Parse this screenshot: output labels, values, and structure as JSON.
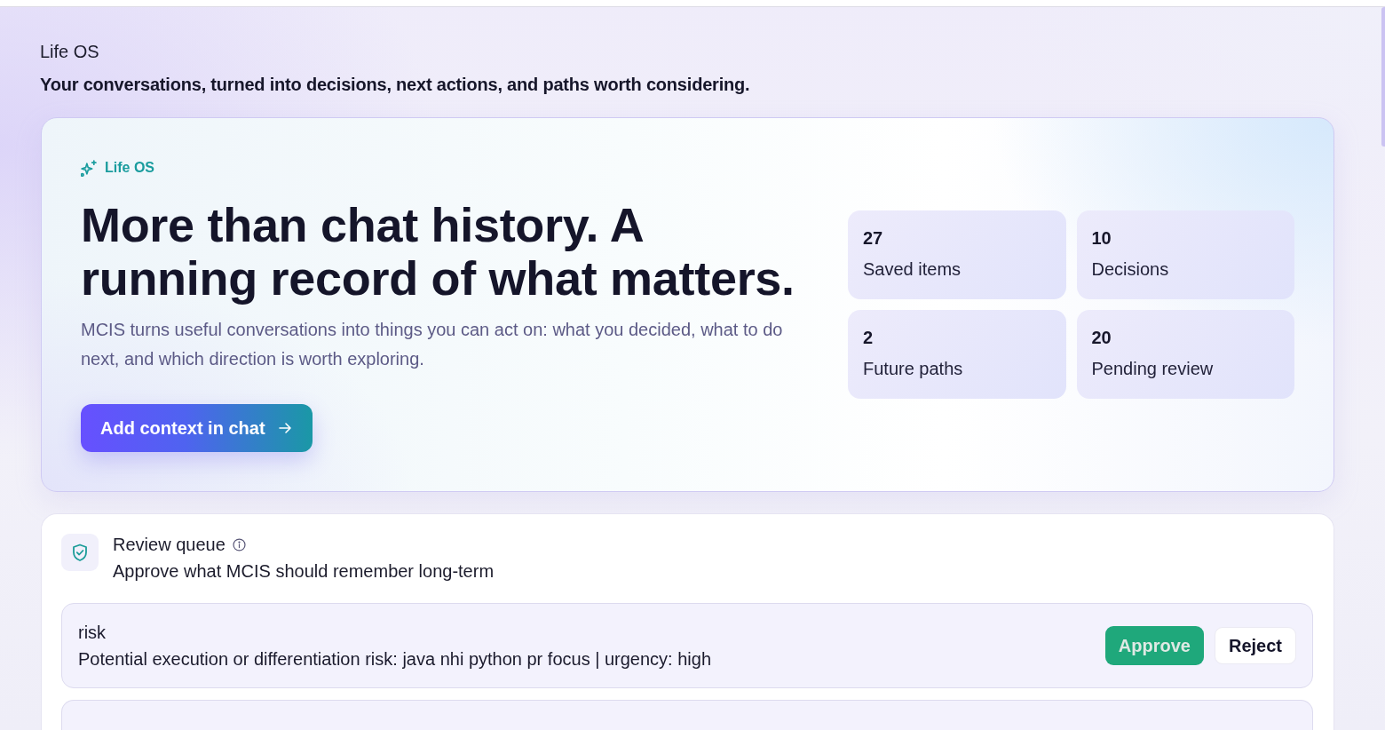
{
  "page": {
    "title": "Life OS",
    "subtitle": "Your conversations, turned into decisions, next actions, and paths worth considering."
  },
  "hero": {
    "badge": "Life OS",
    "headline": "More than chat history. A running record of what matters.",
    "description": "MCIS turns useful conversations into things you can act on: what you decided, what to do next, and which direction is worth exploring.",
    "button": "Add context in chat"
  },
  "stats": [
    {
      "value": "27",
      "label": "Saved items"
    },
    {
      "value": "10",
      "label": "Decisions"
    },
    {
      "value": "2",
      "label": "Future paths"
    },
    {
      "value": "20",
      "label": "Pending review"
    }
  ],
  "review_queue": {
    "title": "Review queue",
    "subtitle": "Approve what MCIS should remember long-term",
    "items": [
      {
        "category": "risk",
        "text": "Potential execution or differentiation risk: java nhi python pr focus | urgency: high",
        "actions": [
          {
            "kind": "approve",
            "label": "Approve",
            "disabled": true
          },
          {
            "kind": "reject",
            "label": "Reject",
            "disabled": false
          }
        ]
      }
    ],
    "more_below": true
  }
}
